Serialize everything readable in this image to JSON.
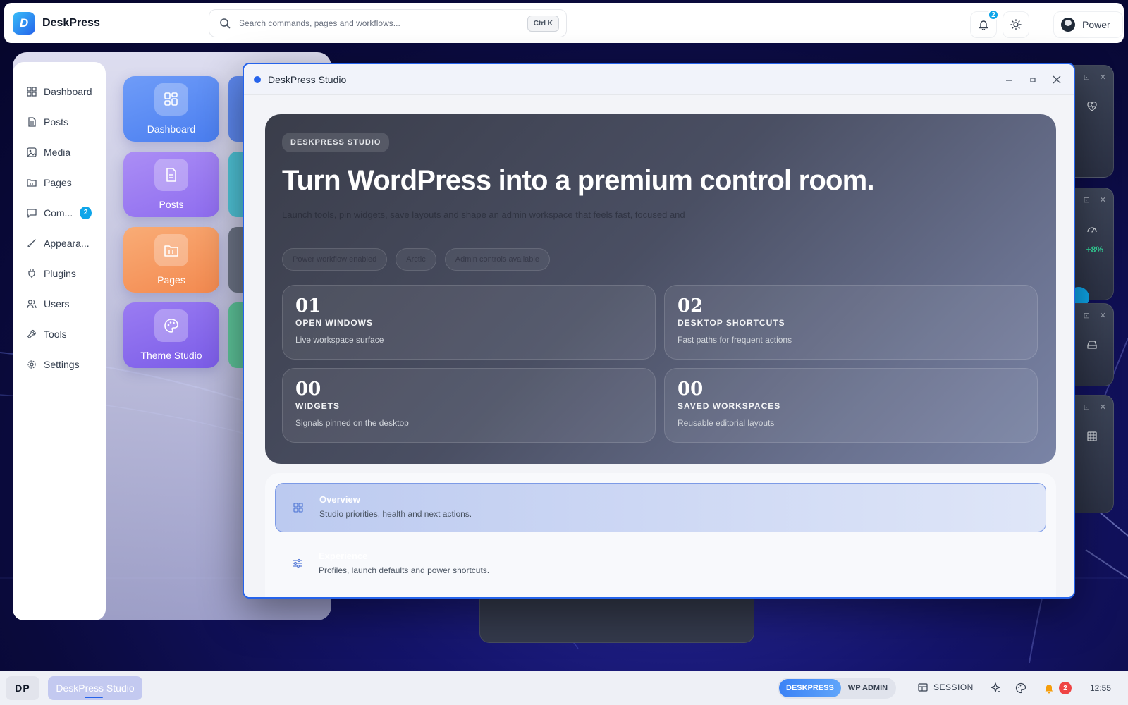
{
  "brand": {
    "logo_letter": "D",
    "name": "DeskPress"
  },
  "search": {
    "placeholder": "Search commands, pages and workflows...",
    "shortcut": "Ctrl K"
  },
  "topbar": {
    "notifications_count": "2",
    "power_label": "Power"
  },
  "sidebar": {
    "items": [
      {
        "label": "Dashboard",
        "icon": "dashboard-icon"
      },
      {
        "label": "Posts",
        "icon": "posts-icon"
      },
      {
        "label": "Media",
        "icon": "media-icon"
      },
      {
        "label": "Pages",
        "icon": "pages-icon"
      },
      {
        "label": "Com...",
        "icon": "comments-icon",
        "badge": "2"
      },
      {
        "label": "Appeara...",
        "icon": "appearance-icon"
      },
      {
        "label": "Plugins",
        "icon": "plugins-icon"
      },
      {
        "label": "Users",
        "icon": "users-icon"
      },
      {
        "label": "Tools",
        "icon": "tools-icon"
      },
      {
        "label": "Settings",
        "icon": "settings-icon"
      }
    ]
  },
  "apps": [
    {
      "label": "Dashboard",
      "color": "#5b8cf5"
    },
    {
      "label": "Posts",
      "color": "#9d7cf0"
    },
    {
      "label": "Pages",
      "color": "#f59a62"
    },
    {
      "label": "Theme Studio",
      "color": "#8b6cf0"
    }
  ],
  "widgets": {
    "delta": "+8%"
  },
  "studio": {
    "window_title": "DeskPress Studio",
    "hero": {
      "eyebrow": "DESKPRESS STUDIO",
      "title": "Turn WordPress into a premium control room.",
      "subtitle": "Launch tools, pin widgets, save layouts and shape an admin workspace that feels fast, focused and",
      "chips": [
        "Power workflow enabled",
        "Arctic",
        "Admin controls available"
      ]
    },
    "stats": [
      {
        "num": "01",
        "label": "OPEN WINDOWS",
        "desc": "Live workspace surface"
      },
      {
        "num": "02",
        "label": "DESKTOP SHORTCUTS",
        "desc": "Fast paths for frequent actions"
      },
      {
        "num": "00",
        "label": "WIDGETS",
        "desc": "Signals pinned on the desktop"
      },
      {
        "num": "00",
        "label": "SAVED WORKSPACES",
        "desc": "Reusable editorial layouts"
      }
    ],
    "nav": [
      {
        "title": "Overview",
        "desc": "Studio priorities, health and next actions."
      },
      {
        "title": "Experience",
        "desc": "Profiles, launch defaults and power shortcuts."
      }
    ]
  },
  "taskbar": {
    "logo": "DP",
    "active_task": "DeskPress Studio",
    "modes": [
      "DESKPRESS",
      "WP ADMIN"
    ],
    "session_label": "SESSION",
    "alerts_count": "2",
    "clock": "12:55"
  }
}
